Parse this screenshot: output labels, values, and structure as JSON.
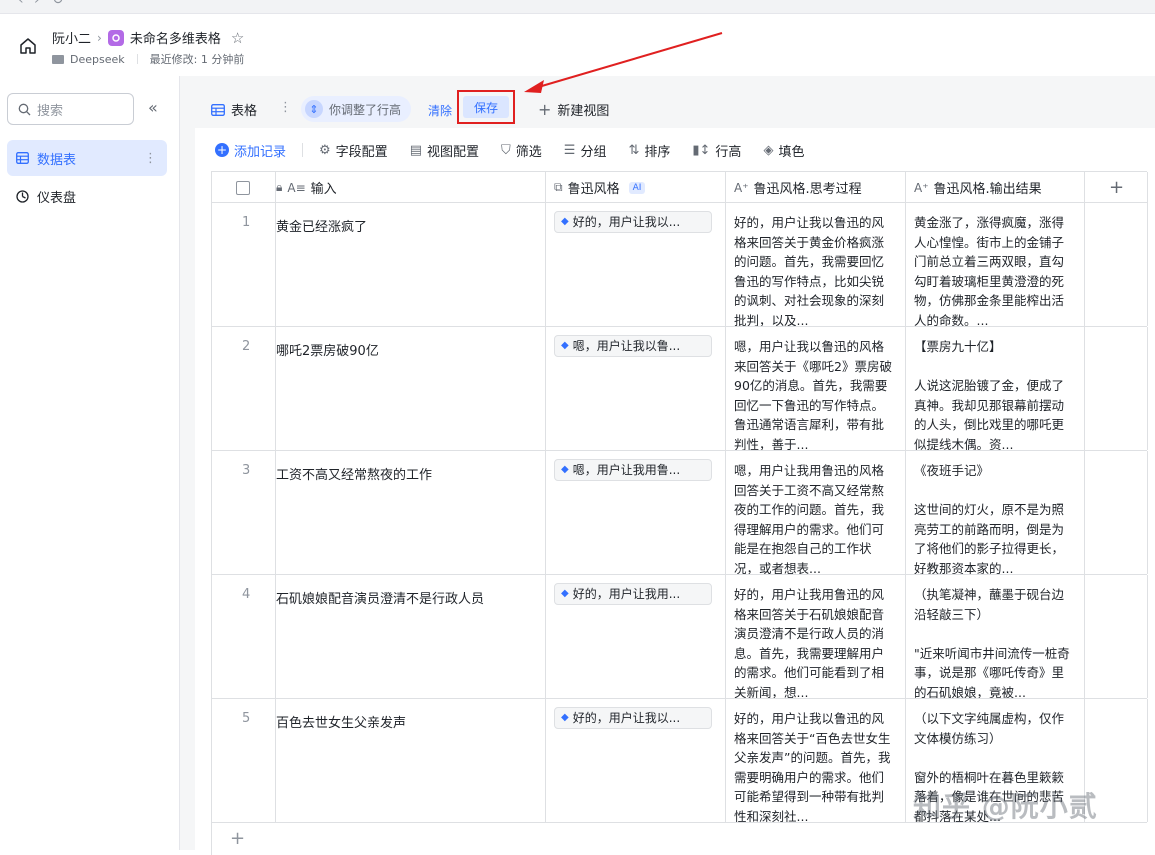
{
  "header": {
    "user": "阮小二",
    "doc_title": "未命名多维表格",
    "folder": "Deepseek",
    "modified": "最近修改: 1 分钟前"
  },
  "sidebar": {
    "search_placeholder": "搜索",
    "items": [
      {
        "label": "数据表"
      },
      {
        "label": "仪表盘"
      }
    ]
  },
  "viewbar": {
    "view_name": "表格",
    "adjust_text": "你调整了行高",
    "clear_label": "清除",
    "save_label": "保存",
    "new_view_label": "新建视图"
  },
  "toolbar": {
    "add_record": "添加记录",
    "field_config": "字段配置",
    "view_config": "视图配置",
    "filter": "筛选",
    "group": "分组",
    "sort": "排序",
    "row_height": "行高",
    "fill": "填色"
  },
  "columns": {
    "input": "输入",
    "style": "鲁迅风格",
    "style_badge": "AI",
    "think": "鲁迅风格.思考过程",
    "output": "鲁迅风格.输出结果"
  },
  "rows": [
    {
      "index": "1",
      "input": "黄金已经涨疯了",
      "style": "好的，用户让我以...",
      "think": "好的，用户让我以鲁迅的风格来回答关于黄金价格疯涨的问题。首先，我需要回忆鲁迅的写作特点，比如尖锐的讽刺、对社会现象的深刻批判，以及...",
      "output": "黄金涨了，涨得疯魔，涨得人心惶惶。街市上的金铺子门前总立着三两双眼，直勾勾盯着玻璃柜里黄澄澄的死物，仿佛那金条里能榨出活人的命数。..."
    },
    {
      "index": "2",
      "input": "哪吒2票房破90亿",
      "style": "嗯，用户让我以鲁...",
      "think": "嗯，用户让我以鲁迅的风格来回答关于《哪吒2》票房破90亿的消息。首先，我需要回忆一下鲁迅的写作特点。鲁迅通常语言犀利，带有批判性，善于...",
      "output": "【票房九十亿】\n\n人说这泥胎镀了金，便成了真神。我却见那银幕前摆动的人头，倒比戏里的哪吒更似提线木偶。资..."
    },
    {
      "index": "3",
      "input": "工资不高又经常熬夜的工作",
      "style": "嗯，用户让我用鲁...",
      "think": "嗯，用户让我用鲁迅的风格回答关于工资不高又经常熬夜的工作的问题。首先，我得理解用户的需求。他们可能是在抱怨自己的工作状况，或者想表...",
      "output": "《夜班手记》\n\n这世间的灯火，原不是为照亮劳工的前路而明，倒是为了将他们的影子拉得更长，好教那资本家的..."
    },
    {
      "index": "4",
      "input": "石矶娘娘配音演员澄清不是行政人员",
      "style": "好的，用户让我用...",
      "think": "好的，用户让我用鲁迅的风格来回答关于石矶娘娘配音演员澄清不是行政人员的消息。首先，我需要理解用户的需求。他们可能看到了相关新闻，想...",
      "output": "（执笔凝神，蘸墨于砚台边沿轻敲三下）\n\n\"近来听闻市井间流传一桩奇事，说是那《哪吒传奇》里的石矶娘娘，竟被..."
    },
    {
      "index": "5",
      "input": "百色去世女生父亲发声",
      "style": "好的，用户让我以...",
      "think": "好的，用户让我以鲁迅的风格来回答关于“百色去世女生父亲发声”的问题。首先，我需要明确用户的需求。他们可能希望得到一种带有批判性和深刻社...",
      "output": "（以下文字纯属虚构，仅作文体模仿练习）\n\n窗外的梧桐叶在暮色里簌簌落着，像是谁在世间的悲苦都抖落在某处..."
    }
  ],
  "watermark": "知乎 @阮小贰"
}
